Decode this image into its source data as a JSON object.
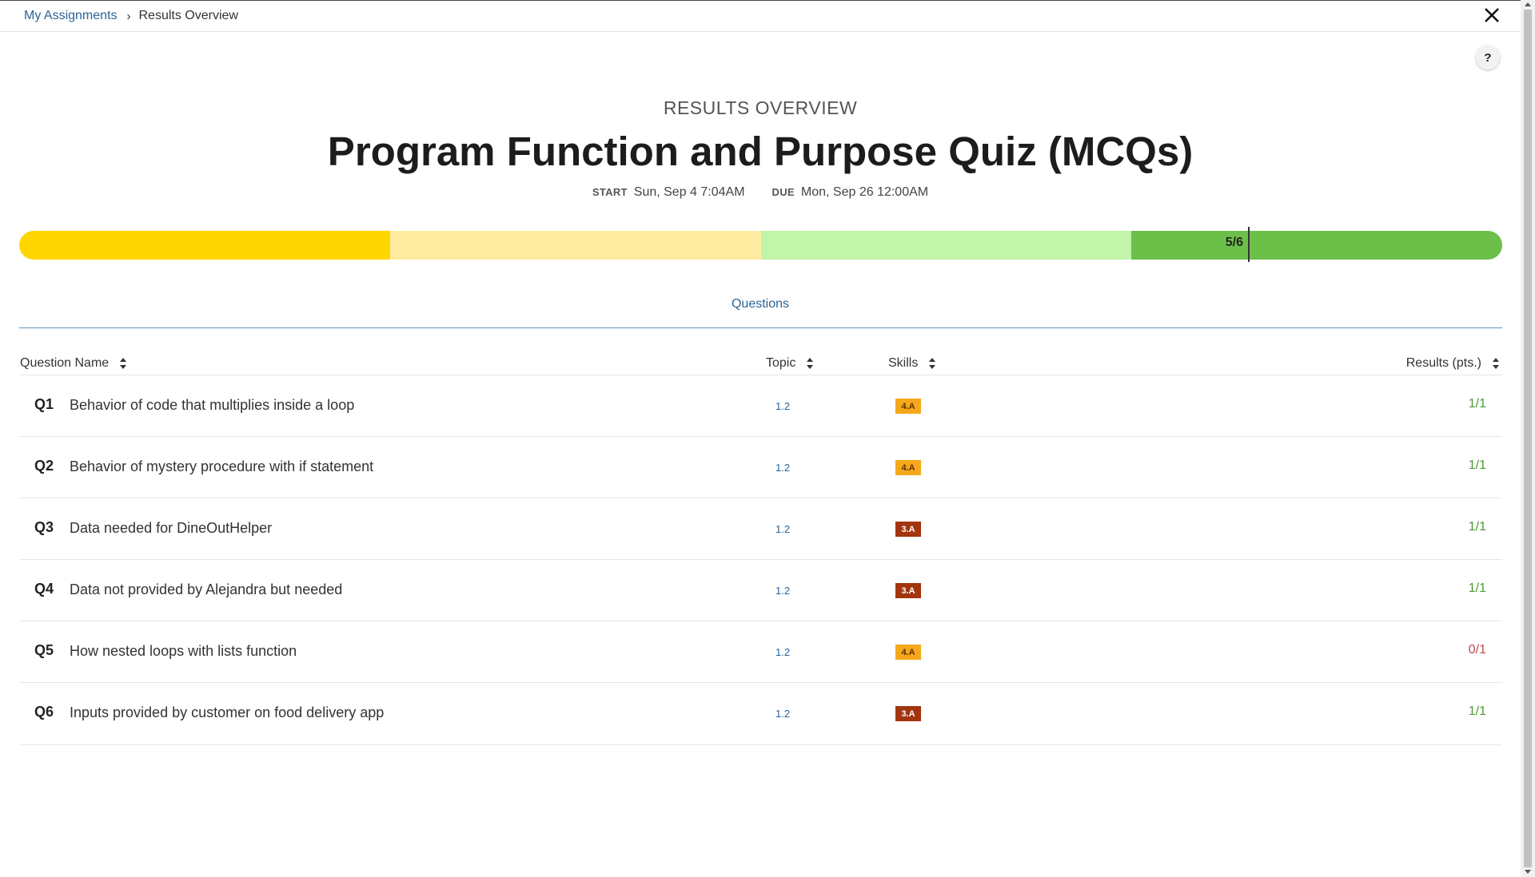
{
  "breadcrumb": {
    "parent": "My Assignments",
    "separator": "›",
    "current": "Results Overview"
  },
  "help_label": "?",
  "header": {
    "eyebrow": "RESULTS OVERVIEW",
    "title": "Program Function and Purpose Quiz (MCQs)",
    "start_label": "START",
    "start_value": "Sun, Sep 4 7:04AM",
    "due_label": "DUE",
    "due_value": "Mon, Sep 26 12:00AM"
  },
  "progress": {
    "score_text": "5/6",
    "earned": 5,
    "total": 6,
    "segment_colors": [
      "#ffd600",
      "#ffeca0",
      "#c2f4aa",
      "#6cc04a"
    ]
  },
  "tab": "Questions",
  "table": {
    "headers": {
      "name": "Question Name",
      "topic": "Topic",
      "skills": "Skills",
      "results": "Results (pts.)"
    },
    "rows": [
      {
        "num": "Q1",
        "name": "Behavior of code that multiplies inside a loop",
        "topic": "1.2",
        "skill": "4.A",
        "result": "1/1"
      },
      {
        "num": "Q2",
        "name": "Behavior of mystery procedure with if statement",
        "topic": "1.2",
        "skill": "4.A",
        "result": "1/1"
      },
      {
        "num": "Q3",
        "name": "Data needed for DineOutHelper",
        "topic": "1.2",
        "skill": "3.A",
        "result": "1/1"
      },
      {
        "num": "Q4",
        "name": "Data not provided by Alejandra but needed",
        "topic": "1.2",
        "skill": "3.A",
        "result": "1/1"
      },
      {
        "num": "Q5",
        "name": "How nested loops with lists function",
        "topic": "1.2",
        "skill": "4.A",
        "result": "0/1"
      },
      {
        "num": "Q6",
        "name": "Inputs provided by customer on food delivery app",
        "topic": "1.2",
        "skill": "3.A",
        "result": "1/1"
      }
    ]
  },
  "colors": {
    "link": "#2a6496",
    "skill_4a": "#f5a81c",
    "skill_3a": "#a2350f",
    "correct": "#4a9a35",
    "incorrect": "#b8484c"
  }
}
